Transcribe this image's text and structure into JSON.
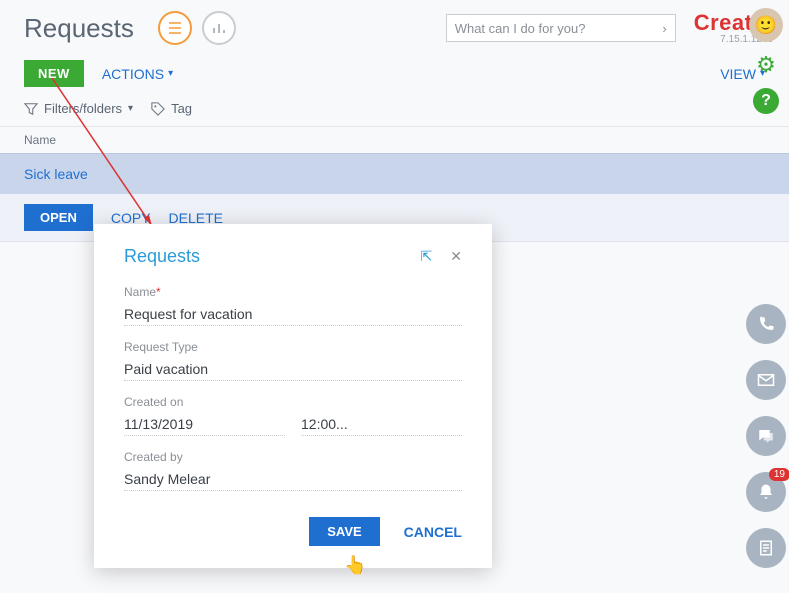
{
  "header": {
    "title": "Requests",
    "search_placeholder": "What can I do for you?",
    "brand": "Creatio",
    "version": "7.15.1.1295"
  },
  "toolbar": {
    "new_label": "NEW",
    "actions_label": "ACTIONS",
    "view_label": "VIEW"
  },
  "filters": {
    "filters_folders": "Filters/folders",
    "tag": "Tag"
  },
  "grid": {
    "column_name": "Name",
    "rows": [
      {
        "name": "Sick leave"
      }
    ],
    "actions": {
      "open": "OPEN",
      "copy": "COPY",
      "delete": "DELETE"
    }
  },
  "modal": {
    "title": "Requests",
    "fields": {
      "name_label": "Name",
      "name_value": "Request for vacation",
      "type_label": "Request Type",
      "type_value": "Paid vacation",
      "created_on_label": "Created on",
      "created_on_date": "11/13/2019",
      "created_on_time": "12:00...",
      "created_by_label": "Created by",
      "created_by_value": "Sandy Melear"
    },
    "save": "SAVE",
    "cancel": "CANCEL"
  },
  "sidebar": {
    "notifications_count": "19"
  }
}
